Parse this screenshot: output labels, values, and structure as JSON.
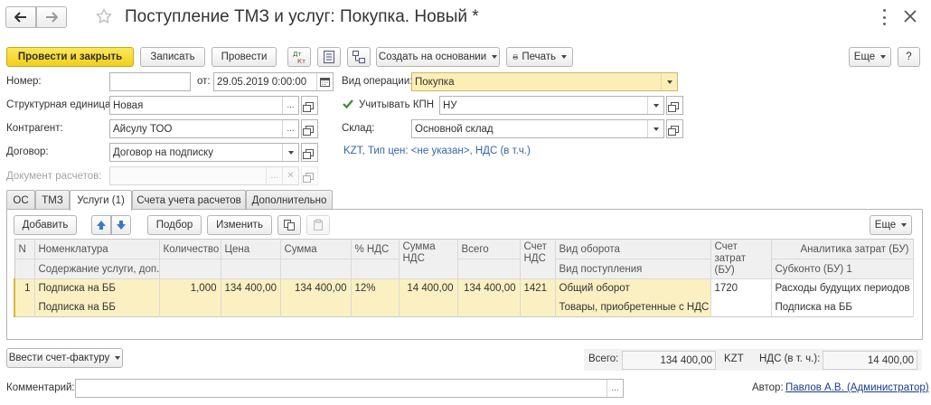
{
  "window": {
    "title": "Поступление ТМЗ и услуг: Покупка. Новый *"
  },
  "nav": {
    "back_icon": "arrow-left-icon",
    "forward_icon": "arrow-right-icon",
    "favorite_icon": "star-icon",
    "more_icon": "vertical-dots-icon",
    "close_icon": "close-icon"
  },
  "toolbar": {
    "post_close": "Провести и закрыть",
    "save": "Записать",
    "post": "Провести",
    "create_based": "Создать на основании",
    "print": "Печать",
    "more": "Еще",
    "help": "?"
  },
  "form": {
    "number_label": "Номер:",
    "number_value": "",
    "date_label": "от:",
    "date_value": "29.05.2019  0:00:00",
    "operation_label": "Вид операции:",
    "operation_value": "Покупка",
    "struct_label": "Структурная единица:",
    "struct_value": "Новая",
    "kpn_check_label": "Учитывать КПН",
    "kpn_value": "НУ",
    "contractor_label": "Контрагент:",
    "contractor_value": "Айсулу ТОО",
    "warehouse_label": "Склад:",
    "warehouse_value": "Основной склад",
    "contract_label": "Договор:",
    "contract_value": "Договор на подписку",
    "price_info": "KZT, Тип цен: <не указан>, НДС (в т.ч.)",
    "settlement_doc_label": "Документ расчетов:",
    "settlement_doc_value": ""
  },
  "tabs": [
    "ОС",
    "ТМЗ",
    "Услуги (1)",
    "Счета учета расчетов",
    "Дополнительно"
  ],
  "table_toolbar": {
    "add": "Добавить",
    "select": "Подбор",
    "edit": "Изменить",
    "more": "Еще"
  },
  "table": {
    "headers_top": [
      "N",
      "Номенклатура",
      "Количество",
      "Цена",
      "Сумма",
      "% НДС",
      "Сумма НДС",
      "Всего",
      "Счет НДС",
      "Вид оборота",
      "Счет затрат (БУ)",
      "Аналитика затрат (БУ)"
    ],
    "headers_bottom": {
      "nomenclature": "Содержание услуги, доп.",
      "turnover": "Вид поступления",
      "analytics": "Субконто (БУ) 1"
    },
    "rows": [
      {
        "n": "1",
        "nomenclature": "Подписка на ББ",
        "content": "Подписка на ББ",
        "qty": "1,000",
        "price": "134 400,00",
        "sum": "134 400,00",
        "vat_pct": "12%",
        "vat_sum": "14 400,00",
        "total": "134 400,00",
        "vat_account": "1421",
        "turnover": "Общий оборот",
        "receipt_type": "Товары, приобретенные с НДС",
        "cost_account": "1720",
        "subconto": "Расходы будущих периодов",
        "analytics2": "Подписка на ББ"
      }
    ]
  },
  "footer": {
    "invoice_btn": "Ввести счет-фактуру",
    "total_label": "Всего:",
    "total_value": "134 400,00",
    "currency": "KZT",
    "vat_label": "НДС (в т. ч.):",
    "vat_value": "14 400,00",
    "comment_label": "Комментарий:",
    "comment_value": "",
    "author_label": "Автор:",
    "author_value": "Павлов А.В. (Администратор)"
  },
  "colors": {
    "primary_button": "#f2cf1c",
    "operation_field": "#fcefb5",
    "selected_row": "#fbf0c2",
    "link": "#1a3c8c"
  }
}
